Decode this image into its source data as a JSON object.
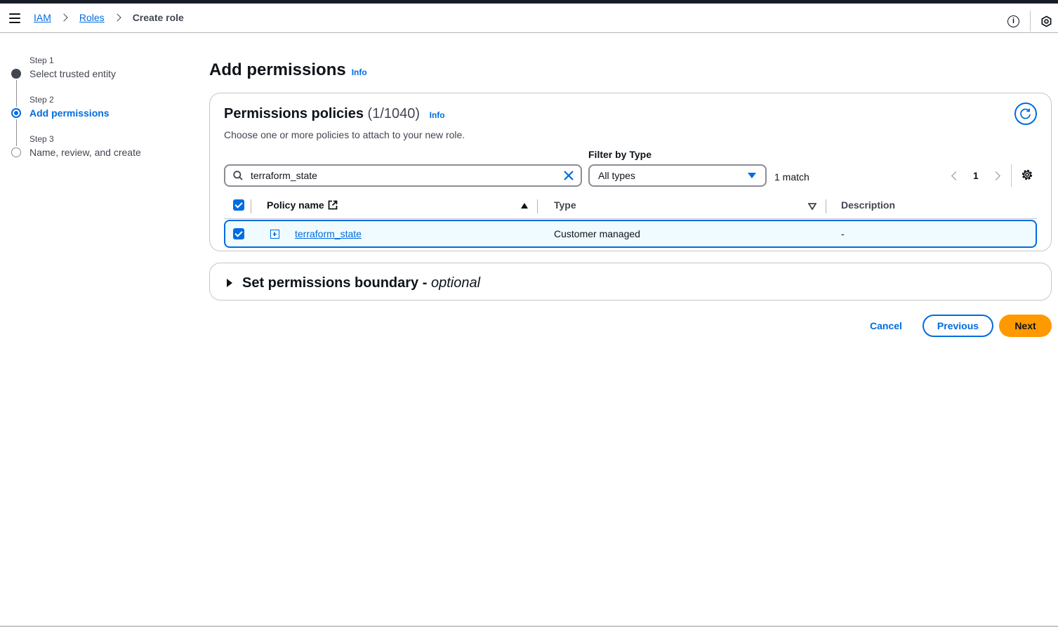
{
  "breadcrumb": {
    "items": [
      "IAM",
      "Roles"
    ],
    "current": "Create role"
  },
  "steps": [
    {
      "label": "Step 1",
      "name": "Select trusted entity",
      "state": "done"
    },
    {
      "label": "Step 2",
      "name": "Add permissions",
      "state": "current"
    },
    {
      "label": "Step 3",
      "name": "Name, review, and create",
      "state": "todo"
    }
  ],
  "page": {
    "title": "Add permissions",
    "info": "Info"
  },
  "policies": {
    "title": "Permissions policies",
    "count": "(1/1040)",
    "info": "Info",
    "description": "Choose one or more policies to attach to your new role.",
    "filter_label": "Filter by Type",
    "search_value": "terraform_state",
    "filter_value": "All types",
    "match_text": "1 match",
    "page_number": "1",
    "columns": {
      "policy_name": "Policy name",
      "type": "Type",
      "description": "Description"
    },
    "rows": [
      {
        "name": "terraform_state",
        "type": "Customer managed",
        "description": "-",
        "checked": true
      }
    ]
  },
  "boundary": {
    "title": "Set permissions boundary - ",
    "optional": "optional"
  },
  "actions": {
    "cancel": "Cancel",
    "previous": "Previous",
    "next": "Next"
  },
  "colors": {
    "accent": "#006ce0",
    "primary_button": "#ff9900",
    "text": "#0f141a",
    "muted": "#424650"
  },
  "icons": [
    "menu-icon",
    "chevron-right-icon",
    "info-icon",
    "cloudshell-icon",
    "refresh-icon",
    "search-icon",
    "clear-icon",
    "caret-down-icon",
    "chevron-left-icon",
    "settings-icon",
    "external-link-icon",
    "sort-ascending-icon",
    "sort-descending-icon",
    "expand-icon",
    "triangle-right-icon"
  ]
}
